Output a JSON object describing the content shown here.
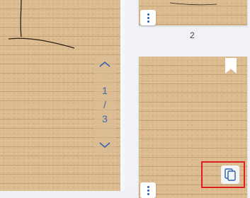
{
  "pager": {
    "current": "1",
    "separator": "/",
    "total": "3",
    "up_icon": "chevron-up-icon",
    "down_icon": "chevron-down-icon"
  },
  "thumbnails": [
    {
      "page_number": "2"
    },
    {
      "page_number": ""
    }
  ],
  "actions": {
    "duplicate_icon": "copy-icon",
    "menu_icon": "more-vertical-icon",
    "bookmark_icon": "bookmark-icon"
  },
  "colors": {
    "paper": "#dcbb8e",
    "accent": "#3b6ab0",
    "highlight": "#e02020"
  }
}
